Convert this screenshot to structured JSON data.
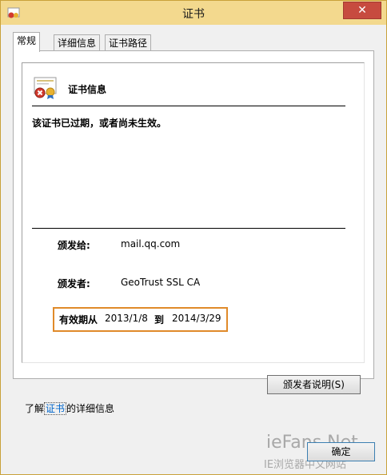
{
  "window": {
    "title": "证书",
    "close": "✕"
  },
  "tabs": [
    {
      "label": "常规",
      "active": true
    },
    {
      "label": "详细信息",
      "active": false
    },
    {
      "label": "证书路径",
      "active": false
    }
  ],
  "info": {
    "title": "证书信息",
    "status": "该证书已过期，或者尚未生效。",
    "issued_to_label": "颁发给:",
    "issued_to": "mail.qq.com",
    "issued_by_label": "颁发者:",
    "issued_by": "GeoTrust SSL CA",
    "valid_from_label": "有效期从",
    "valid_from": "2013/1/8",
    "to_label": "到",
    "valid_to": "2014/3/29"
  },
  "buttons": {
    "issuer_statement": "颁发者说明(S)",
    "ok": "确定"
  },
  "learn": {
    "prefix": "了解",
    "link": "证书",
    "suffix": "的详细信息"
  },
  "watermark": {
    "brand": "ieFans.Net",
    "subtitle": "IE浏览器中文网站"
  },
  "colors": {
    "titlebar": "#f3d98e",
    "close": "#c74b3f",
    "highlight": "#e08a2a",
    "link": "#0066cc"
  }
}
